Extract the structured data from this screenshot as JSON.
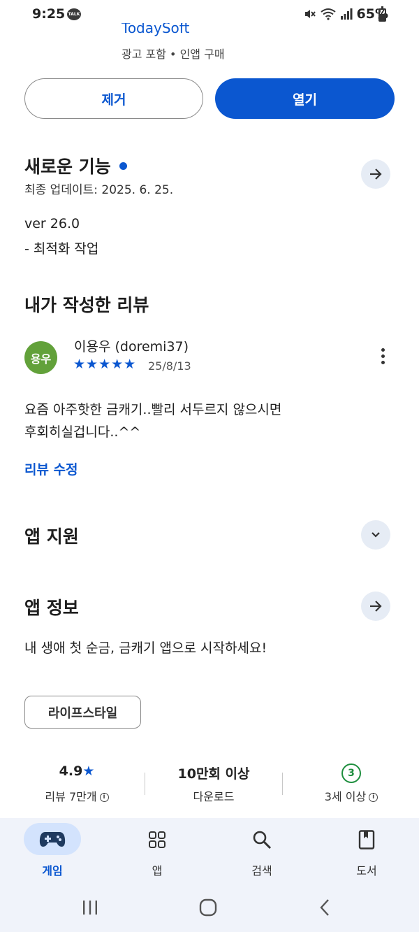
{
  "status": {
    "time": "9:25",
    "talk": "TALK",
    "battery": "65%"
  },
  "app": {
    "developer": "TodaySoft",
    "subtitle": "광고 포함 • 인앱 구매"
  },
  "actions": {
    "remove": "제거",
    "open": "열기"
  },
  "whats_new": {
    "title": "새로운 기능",
    "updated": "최종 업데이트: 2025. 6. 25.",
    "version": "ver 26.0",
    "notes": "- 최적화 작업"
  },
  "my_review": {
    "title": "내가 작성한 리뷰",
    "avatar": "용우",
    "reviewer": "이용우 (doremi37)",
    "stars": "★★★★★",
    "rating": 5,
    "date": "25/8/13",
    "text_line1": "요즘 아주핫한 금캐기..빨리 서두르지 않으시면",
    "text_line2": "후회히실겁니다..^^",
    "edit": "리뷰 수정"
  },
  "app_support": {
    "title": "앱 지원"
  },
  "app_info": {
    "title": "앱 정보",
    "description": "내 생애 첫 순금, 금캐기 앱으로 시작하세요!",
    "category": "라이프스타일"
  },
  "stats": {
    "rating": "4.9",
    "reviews": "리뷰 7만개",
    "downloads": "10만회 이상",
    "downloads_label": "다운로드",
    "age_badge": "3",
    "age_label": "3세 이상"
  },
  "nav": {
    "games": "게임",
    "apps": "앱",
    "search": "검색",
    "books": "도서"
  },
  "colors": {
    "accent": "#0b57d0",
    "avatar": "#62a13a",
    "age": "#1e8e3e"
  }
}
